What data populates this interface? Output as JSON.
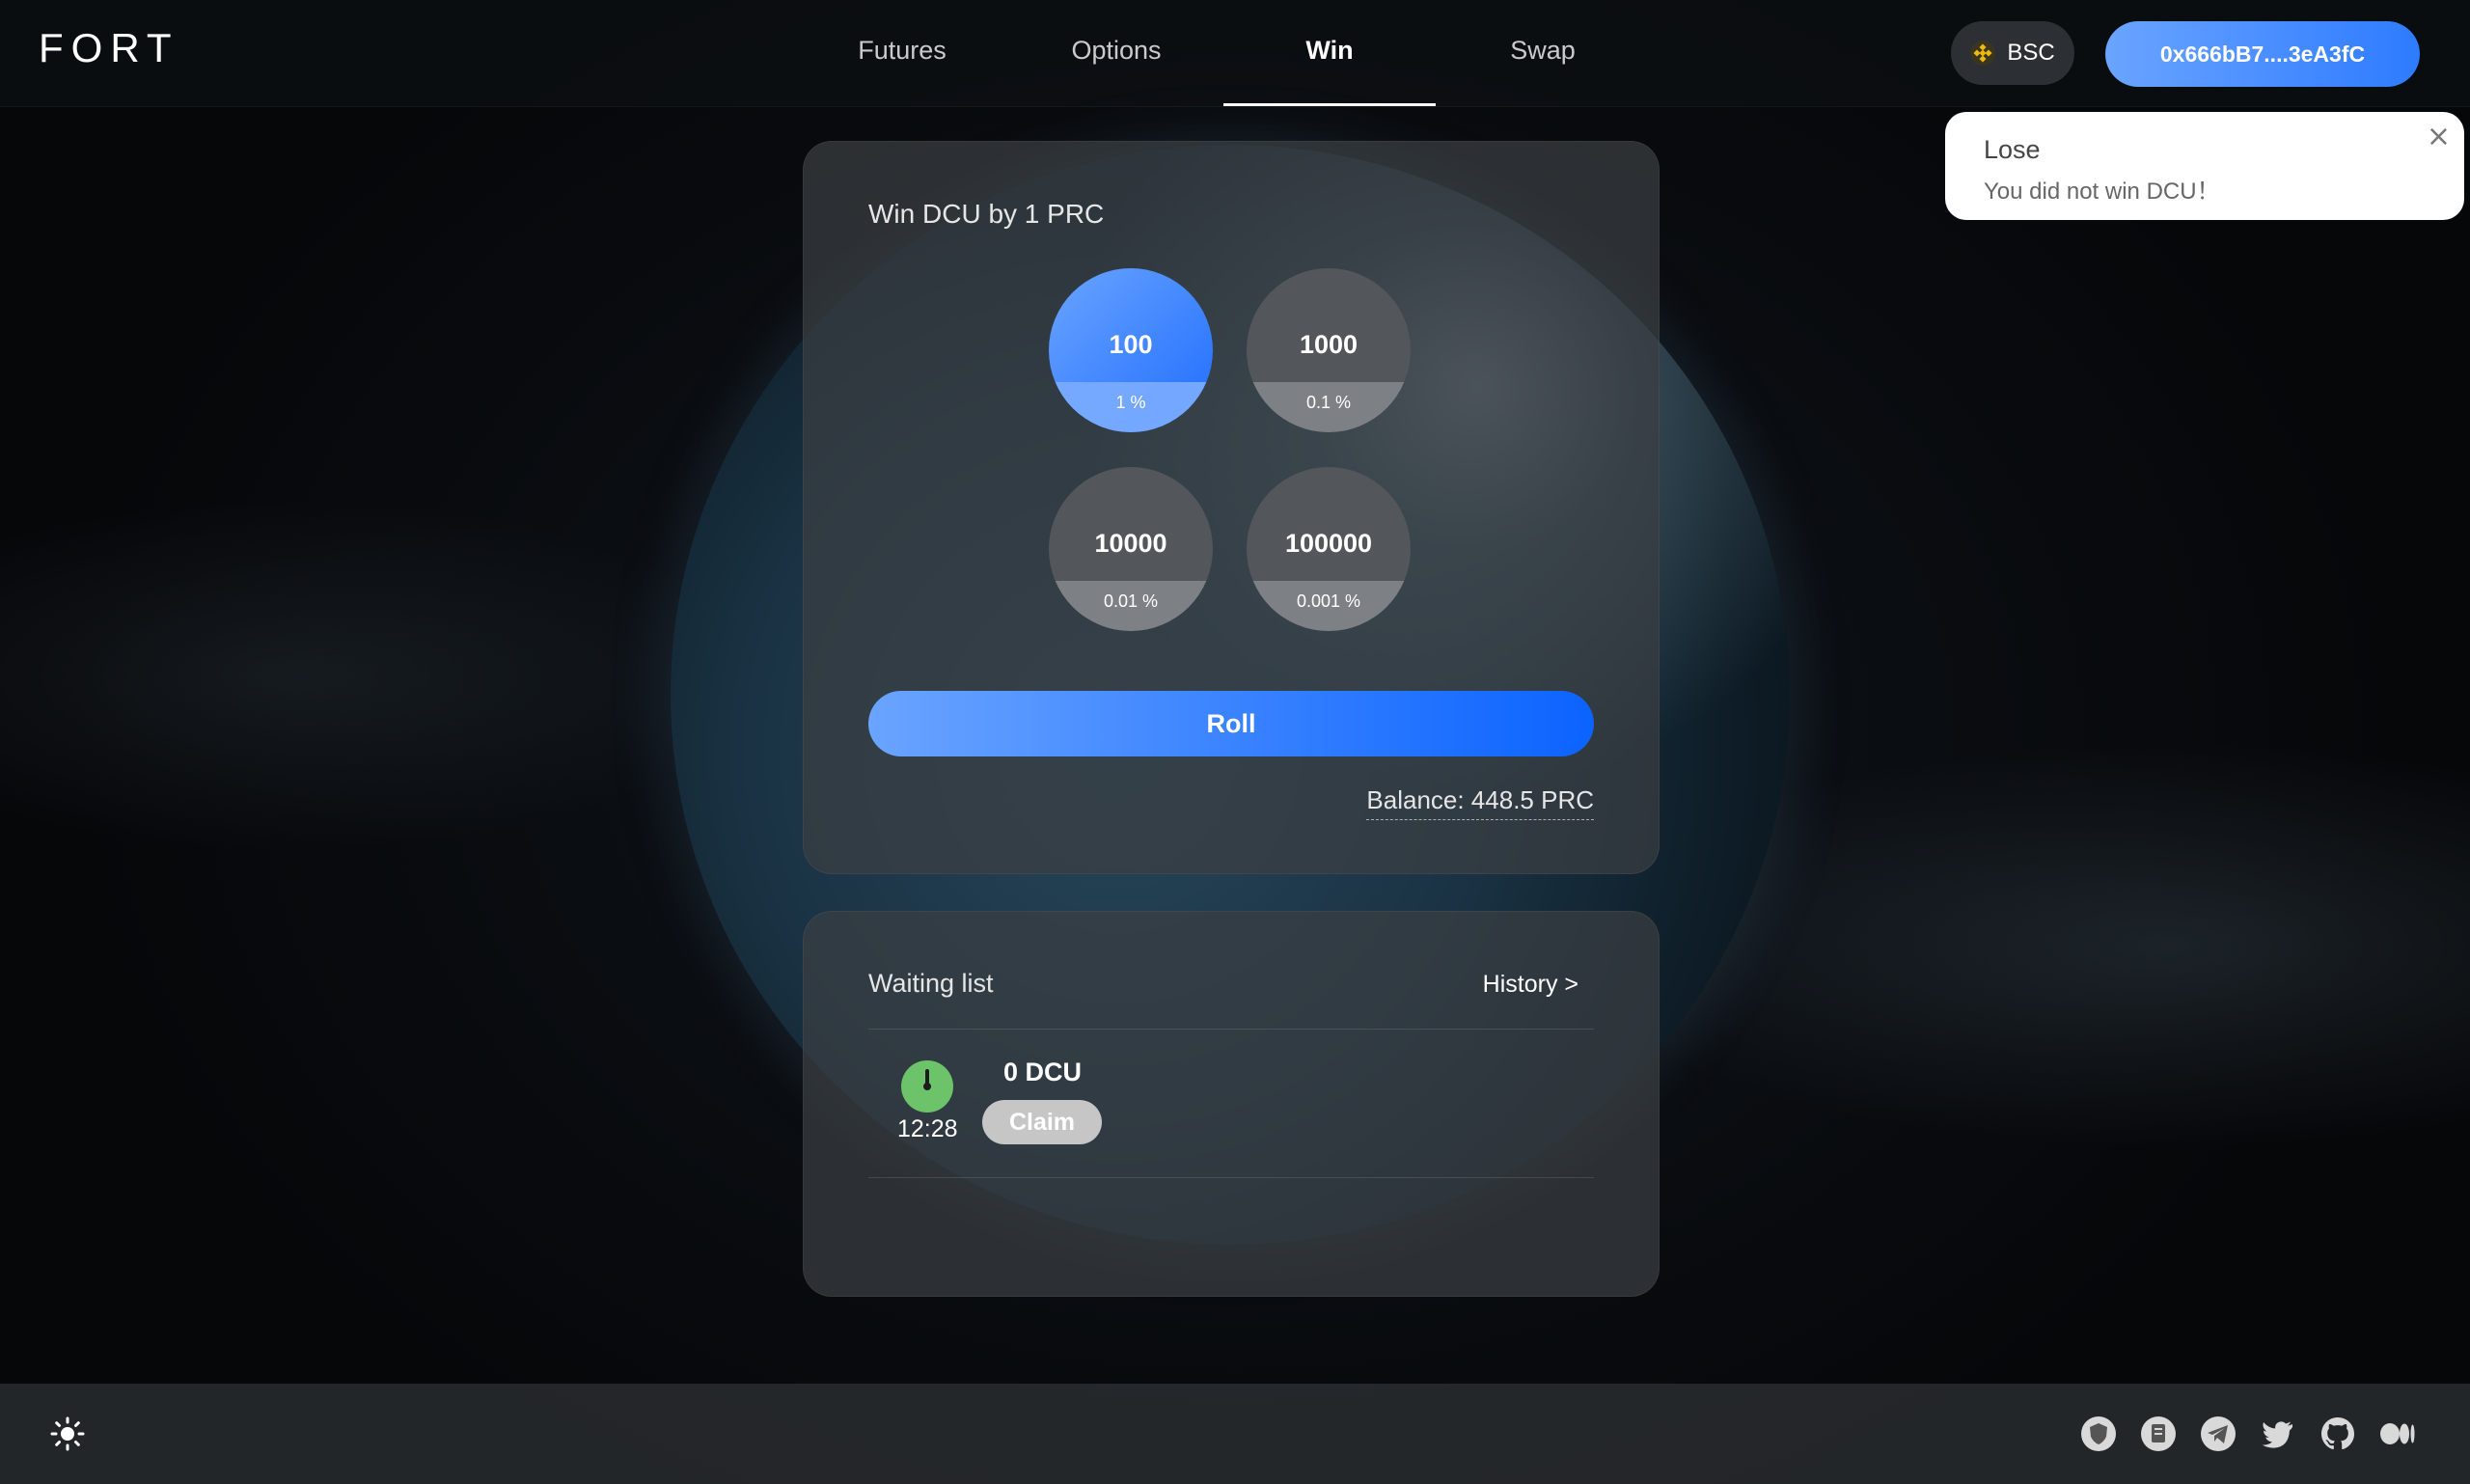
{
  "header": {
    "logo": "FORT",
    "tabs": [
      {
        "label": "Futures",
        "active": false
      },
      {
        "label": "Options",
        "active": false
      },
      {
        "label": "Win",
        "active": true
      },
      {
        "label": "Swap",
        "active": false
      }
    ],
    "chain": {
      "label": "BSC",
      "icon": "bnb-icon"
    },
    "wallet": "0x666bB7....3eA3fC"
  },
  "toast": {
    "title": "Lose",
    "message": "You did not win DCU！",
    "close_icon": "close-icon"
  },
  "win_card": {
    "title": "Win DCU by 1 PRC",
    "options": [
      {
        "amount": "100",
        "percent": "1 %",
        "selected": true
      },
      {
        "amount": "1000",
        "percent": "0.1 %",
        "selected": false
      },
      {
        "amount": "10000",
        "percent": "0.01 %",
        "selected": false
      },
      {
        "amount": "100000",
        "percent": "0.001 %",
        "selected": false
      }
    ],
    "roll_label": "Roll",
    "balance": "Balance: 448.5 PRC"
  },
  "waiting_card": {
    "title": "Waiting list",
    "history_label": "History >",
    "items": [
      {
        "time": "12:28",
        "amount": "0 DCU",
        "claim_label": "Claim",
        "icon": "clock-icon"
      }
    ]
  },
  "footer": {
    "theme_icon": "sun-icon",
    "social_icons": [
      "shield-icon",
      "document-icon",
      "telegram-icon",
      "twitter-icon",
      "github-icon",
      "medium-icon"
    ]
  },
  "colors": {
    "accent": "#2d7bff",
    "accent_light": "#6aa4ff",
    "clock_green": "#6cc36a"
  }
}
